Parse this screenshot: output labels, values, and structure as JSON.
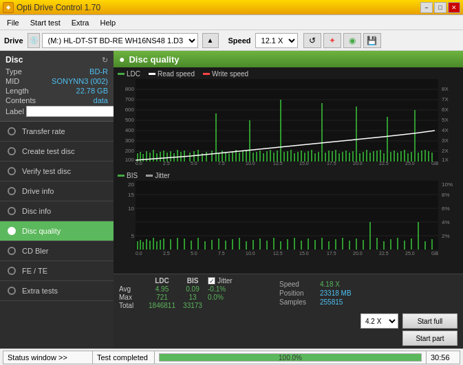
{
  "titlebar": {
    "title": "Opti Drive Control 1.70",
    "icon": "◆",
    "minimize": "−",
    "maximize": "□",
    "close": "✕"
  },
  "menubar": {
    "items": [
      "File",
      "Start test",
      "Extra",
      "Help"
    ]
  },
  "drivebar": {
    "drive_label": "Drive",
    "drive_value": "(M:)  HL-DT-ST BD-RE  WH16NS48 1.D3",
    "speed_label": "Speed",
    "speed_value": "12.1 X",
    "eject_icon": "▲",
    "refresh_icon": "↺"
  },
  "disc": {
    "title": "Disc",
    "type_label": "Type",
    "type_value": "BD-R",
    "mid_label": "MID",
    "mid_value": "SONYNN3 (002)",
    "length_label": "Length",
    "length_value": "22.78 GB",
    "contents_label": "Contents",
    "contents_value": "data",
    "label_label": "Label",
    "label_value": ""
  },
  "sidebar": {
    "items": [
      {
        "id": "transfer-rate",
        "label": "Transfer rate",
        "active": false
      },
      {
        "id": "create-test-disc",
        "label": "Create test disc",
        "active": false
      },
      {
        "id": "verify-test-disc",
        "label": "Verify test disc",
        "active": false
      },
      {
        "id": "drive-info",
        "label": "Drive info",
        "active": false
      },
      {
        "id": "disc-info",
        "label": "Disc info",
        "active": false
      },
      {
        "id": "disc-quality",
        "label": "Disc quality",
        "active": true
      },
      {
        "id": "cd-bler",
        "label": "CD Bler",
        "active": false
      },
      {
        "id": "fe-te",
        "label": "FE / TE",
        "active": false
      },
      {
        "id": "extra-tests",
        "label": "Extra tests",
        "active": false
      }
    ]
  },
  "quality": {
    "title": "Disc quality",
    "icon": "●",
    "chart1": {
      "legend": [
        "LDC",
        "Read speed",
        "Write speed"
      ],
      "y_max": 800,
      "y_labels": [
        "800",
        "700",
        "600",
        "500",
        "400",
        "300",
        "200",
        "100"
      ],
      "x_labels": [
        "0.0",
        "2.5",
        "5.0",
        "7.5",
        "10.0",
        "12.5",
        "15.0",
        "17.5",
        "20.0",
        "22.5",
        "25.0"
      ],
      "y_right": [
        "8X",
        "7X",
        "6X",
        "5X",
        "4X",
        "3X",
        "2X",
        "1X"
      ],
      "gb_label": "GB"
    },
    "chart2": {
      "legend": [
        "BIS",
        "Jitter"
      ],
      "y_max": 20,
      "y_labels": [
        "20",
        "15",
        "10",
        "5"
      ],
      "x_labels": [
        "0.0",
        "2.5",
        "5.0",
        "7.5",
        "10.0",
        "12.5",
        "15.0",
        "17.5",
        "20.0",
        "22.5",
        "25.0"
      ],
      "y_right": [
        "10%",
        "8%",
        "6%",
        "4%",
        "2%"
      ],
      "gb_label": "GB"
    },
    "stats": {
      "headers": [
        "",
        "LDC",
        "BIS",
        "",
        "Jitter"
      ],
      "avg_label": "Avg",
      "avg_ldc": "4.95",
      "avg_bis": "0.09",
      "avg_jitter": "-0.1%",
      "max_label": "Max",
      "max_ldc": "721",
      "max_bis": "13",
      "max_jitter": "0.0%",
      "total_label": "Total",
      "total_ldc": "1846811",
      "total_bis": "33173",
      "speed_label": "Speed",
      "speed_value": "4.18 X",
      "position_label": "Position",
      "position_value": "23318 MB",
      "samples_label": "Samples",
      "samples_value": "255815",
      "jitter_checked": true,
      "speed_dropdown": "4.2 X",
      "start_full": "Start full",
      "start_part": "Start part"
    }
  },
  "status": {
    "panel_label": "Status window >>",
    "completed_text": "Test completed",
    "progress_percent": "100.0%",
    "time": "30:56"
  }
}
